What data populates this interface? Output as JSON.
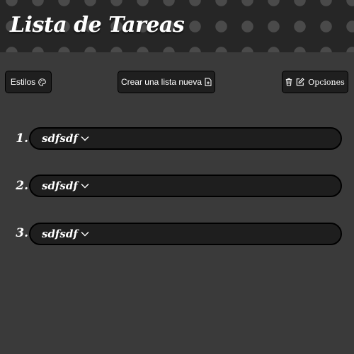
{
  "header": {
    "title": "Lista de Tareas"
  },
  "toolbar": {
    "styles_label": "Estilos",
    "create_label": "Crear una lista nueva",
    "options_label": "Opciones"
  },
  "lists": [
    {
      "number": "1.",
      "name": "sdfsdf"
    },
    {
      "number": "2.",
      "name": "sdfsdf"
    },
    {
      "number": "3.",
      "name": "sdfsdf"
    }
  ]
}
